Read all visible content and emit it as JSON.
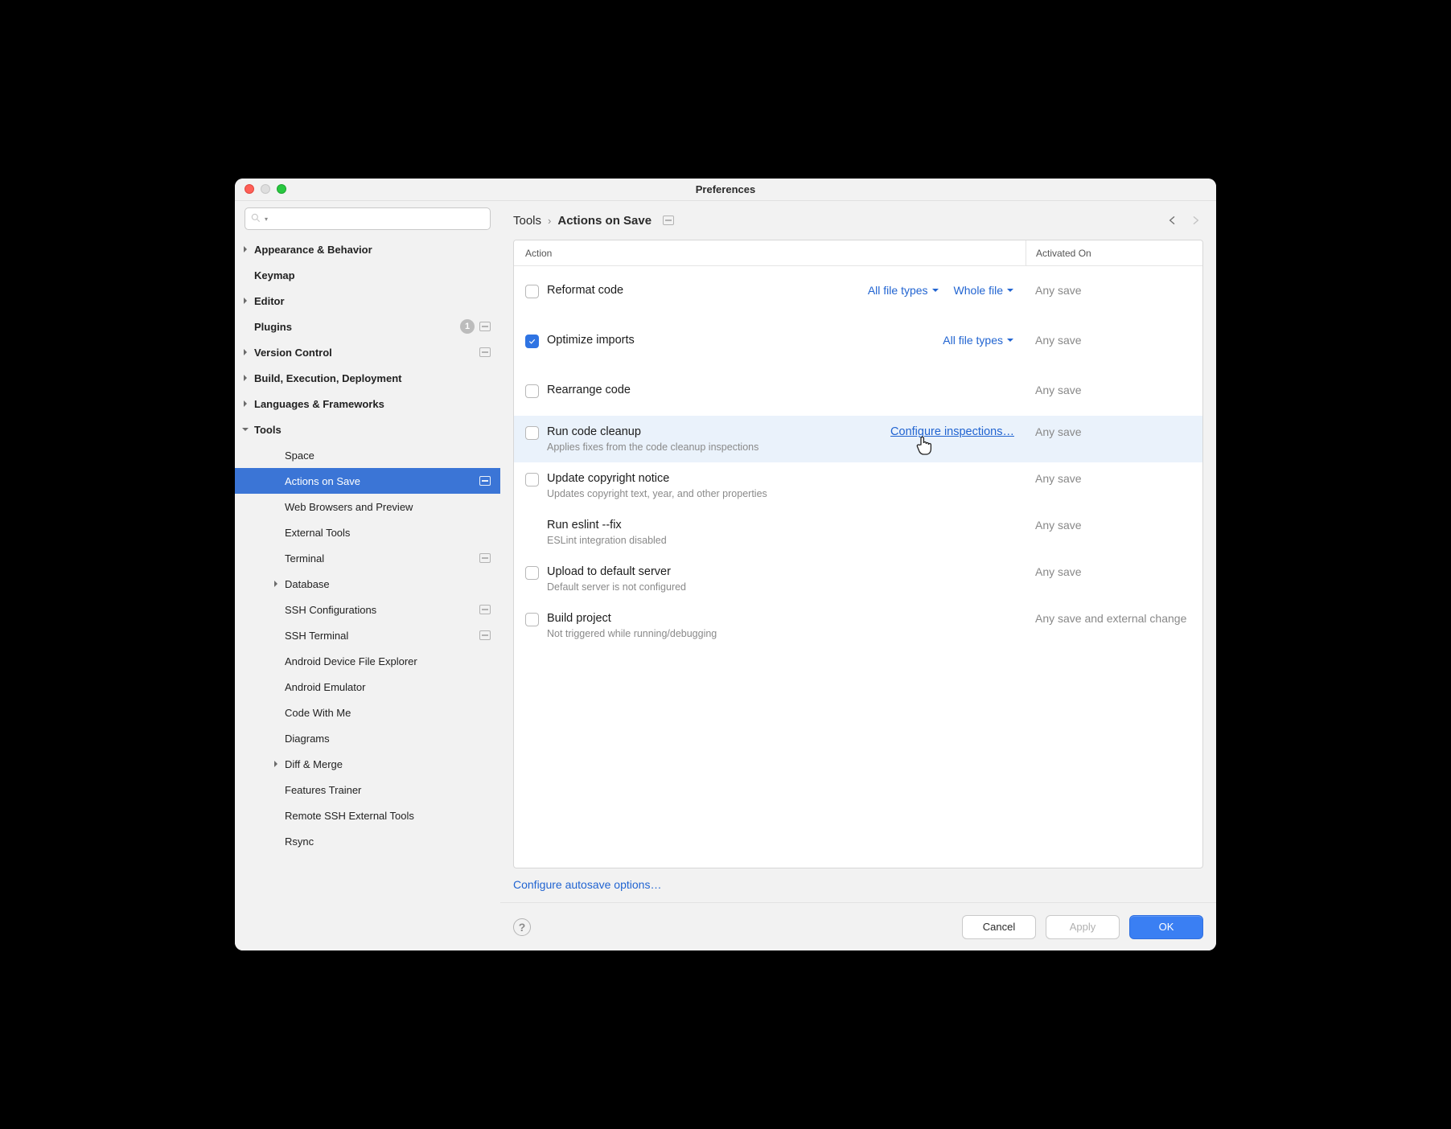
{
  "window": {
    "title": "Preferences"
  },
  "search": {
    "placeholder": ""
  },
  "sidebar": {
    "items": [
      {
        "label": "Appearance & Behavior",
        "top": true,
        "arrow": "right"
      },
      {
        "label": "Keymap",
        "top": true
      },
      {
        "label": "Editor",
        "top": true,
        "arrow": "right"
      },
      {
        "label": "Plugins",
        "top": true,
        "badge": "1",
        "proj": true
      },
      {
        "label": "Version Control",
        "top": true,
        "arrow": "right",
        "proj": true
      },
      {
        "label": "Build, Execution, Deployment",
        "top": true,
        "arrow": "right"
      },
      {
        "label": "Languages & Frameworks",
        "top": true,
        "arrow": "right"
      },
      {
        "label": "Tools",
        "top": true,
        "arrow": "down"
      },
      {
        "label": "Space",
        "child": true
      },
      {
        "label": "Actions on Save",
        "child": true,
        "selected": true,
        "proj": true
      },
      {
        "label": "Web Browsers and Preview",
        "child": true
      },
      {
        "label": "External Tools",
        "child": true
      },
      {
        "label": "Terminal",
        "child": true,
        "proj": true
      },
      {
        "label": "Database",
        "child": true,
        "arrow": "right"
      },
      {
        "label": "SSH Configurations",
        "child": true,
        "proj": true
      },
      {
        "label": "SSH Terminal",
        "child": true,
        "proj": true
      },
      {
        "label": "Android Device File Explorer",
        "child": true
      },
      {
        "label": "Android Emulator",
        "child": true
      },
      {
        "label": "Code With Me",
        "child": true
      },
      {
        "label": "Diagrams",
        "child": true
      },
      {
        "label": "Diff & Merge",
        "child": true,
        "arrow": "right"
      },
      {
        "label": "Features Trainer",
        "child": true
      },
      {
        "label": "Remote SSH External Tools",
        "child": true
      },
      {
        "label": "Rsync",
        "child": true
      }
    ]
  },
  "breadcrumb": {
    "parent": "Tools",
    "current": "Actions on Save"
  },
  "table": {
    "headers": {
      "action": "Action",
      "activated": "Activated On"
    },
    "rows": [
      {
        "title": "Reformat code",
        "checked": false,
        "dd": [
          "All file types",
          "Whole file"
        ],
        "activated": "Any save",
        "spaced": true
      },
      {
        "title": "Optimize imports",
        "checked": true,
        "dd": [
          "All file types"
        ],
        "activated": "Any save",
        "spaced": true
      },
      {
        "title": "Rearrange code",
        "checked": false,
        "activated": "Any save",
        "spaced": true
      },
      {
        "title": "Run code cleanup",
        "desc": "Applies fixes from the code cleanup inspections",
        "checked": false,
        "link": "Configure inspections…",
        "activated": "Any save",
        "hover": true
      },
      {
        "title": "Update copyright notice",
        "desc": "Updates copyright text, year, and other properties",
        "checked": false,
        "activated": "Any save"
      },
      {
        "title": "Run eslint --fix",
        "desc": "ESLint integration disabled",
        "nocheck": true,
        "activated": "Any save"
      },
      {
        "title": "Upload to default server",
        "desc": "Default server is not configured",
        "checked": false,
        "activated": "Any save"
      },
      {
        "title": "Build project",
        "desc": "Not triggered while running/debugging",
        "checked": false,
        "activated": "Any save and external change"
      }
    ]
  },
  "autosave_link": "Configure autosave options…",
  "footer": {
    "cancel": "Cancel",
    "apply": "Apply",
    "ok": "OK"
  }
}
